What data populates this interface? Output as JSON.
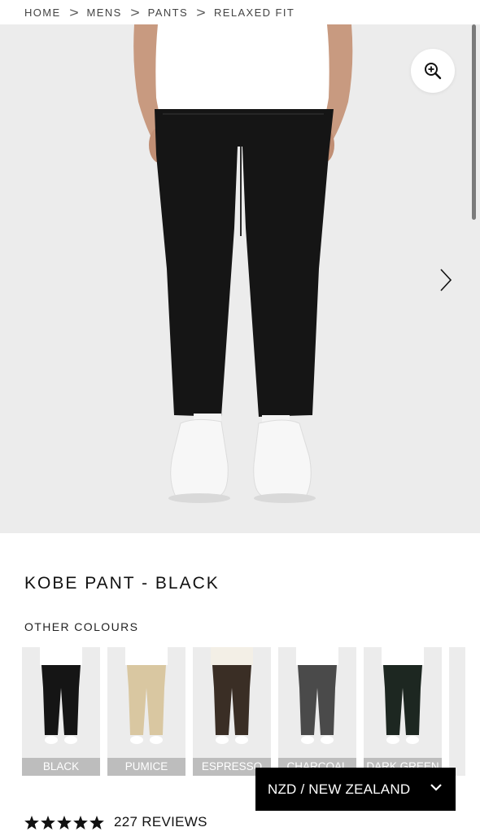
{
  "breadcrumb": {
    "items": [
      "HOME",
      "MENS",
      "PANTS",
      "RELAXED FIT"
    ],
    "separator": ">"
  },
  "hero": {
    "zoom_icon": "zoom-in-icon",
    "next_icon": "chevron-right-icon",
    "background": "#ececec"
  },
  "product": {
    "title": "KOBE PANT - BLACK"
  },
  "colours": {
    "label": "OTHER COLOURS",
    "items": [
      {
        "name": "BLACK",
        "pant": "#151515"
      },
      {
        "name": "PUMICE",
        "pant": "#d9c7a1"
      },
      {
        "name": "ESPRESSO",
        "pant": "#3a2e25"
      },
      {
        "name": "CHARCOAL",
        "pant": "#4a4a4a"
      },
      {
        "name": "DARK GREEN",
        "pant": "#1d2721"
      }
    ]
  },
  "rating": {
    "stars": 5,
    "reviews_label": "227 REVIEWS"
  },
  "currency": {
    "label": "NZD / NEW ZEALAND",
    "icon": "chevron-down-icon"
  }
}
